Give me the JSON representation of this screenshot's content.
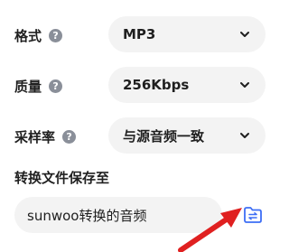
{
  "settings": {
    "format": {
      "label": "格式",
      "help_icon": "question-circle-icon",
      "value": "MP3"
    },
    "quality": {
      "label": "质量",
      "help_icon": "question-circle-icon",
      "value": "256Kbps"
    },
    "sample_rate": {
      "label": "采样率",
      "help_icon": "question-circle-icon",
      "value": "与源音频一致"
    }
  },
  "output": {
    "title": "转换文件保存至",
    "path": "sunwoo转换的音频",
    "browse_icon": "folder-switch-icon"
  },
  "annotation": {
    "arrow_color": "#e02020"
  },
  "colors": {
    "accent": "#3d6ef5",
    "field_bg": "#f3f3f3",
    "help_icon": "#8a8f99"
  }
}
